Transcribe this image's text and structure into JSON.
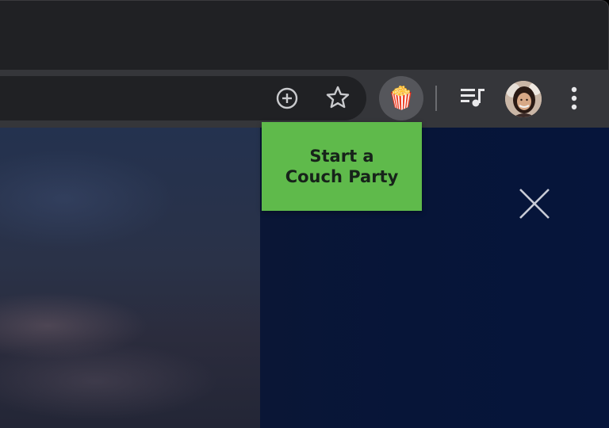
{
  "browser": {
    "toolbar": {
      "icons": {
        "add": "add-circle-icon",
        "bookmark": "star-icon",
        "extension": "popcorn-icon",
        "media": "queue-music-icon",
        "menu": "more-vertical-icon"
      },
      "extension_emoji": "🍿"
    }
  },
  "popup": {
    "label": "Start a\nCouch Party",
    "color": "#5fba4b"
  },
  "content": {
    "close_icon": "close-icon",
    "background_color": "#071538"
  }
}
